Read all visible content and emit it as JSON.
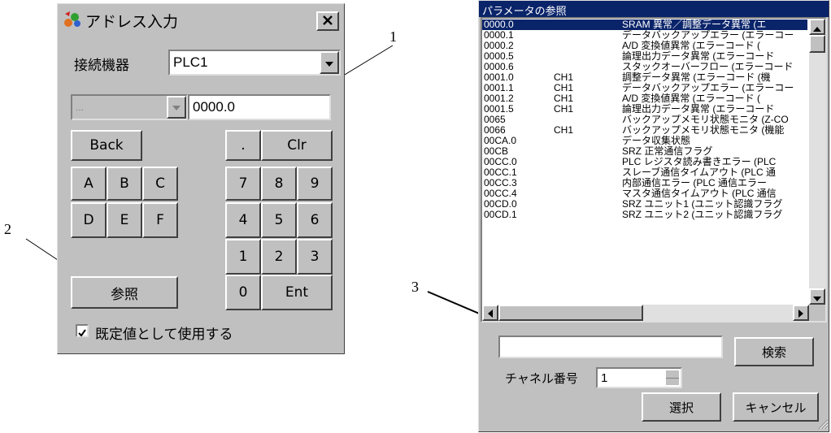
{
  "address_dialog": {
    "title": "アドレス入力",
    "device_label": "接続機器",
    "device_value": "PLC1",
    "sub_select_value": "...",
    "address_value": "0000.0",
    "keys": {
      "back": "Back",
      "dot": ".",
      "clr": "Clr",
      "a": "A",
      "b": "B",
      "c": "C",
      "d": "D",
      "e": "E",
      "f": "F",
      "k7": "7",
      "k8": "8",
      "k9": "9",
      "k4": "4",
      "k5": "5",
      "k6": "6",
      "k1": "1",
      "k2": "2",
      "k3": "3",
      "k0": "0",
      "ent": "Ent",
      "ref": "参照"
    },
    "default_checkbox_label": "既定値として使用する",
    "default_checked": true
  },
  "param_dialog": {
    "title": "パラメータの参照",
    "rows": [
      {
        "addr": "0000.0",
        "ch": "",
        "desc": "SRAM 異常／調整データ異常 (エ"
      },
      {
        "addr": "0000.1",
        "ch": "",
        "desc": "データバックアップエラー (エラーコー"
      },
      {
        "addr": "0000.2",
        "ch": "",
        "desc": "A/D 変換値異常 (エラーコード ("
      },
      {
        "addr": "0000.5",
        "ch": "",
        "desc": "論理出力データ異常 (エラーコード"
      },
      {
        "addr": "0000.6",
        "ch": "",
        "desc": "スタックオーバーフロー (エラーコード"
      },
      {
        "addr": "0001.0",
        "ch": "CH1",
        "desc": "調整データ異常 (エラーコード (機"
      },
      {
        "addr": "0001.1",
        "ch": "CH1",
        "desc": "データバックアップエラー (エラーコー"
      },
      {
        "addr": "0001.2",
        "ch": "CH1",
        "desc": "A/D 変換値異常 (エラーコード ("
      },
      {
        "addr": "0001.5",
        "ch": "CH1",
        "desc": "論理出力データ異常 (エラーコード"
      },
      {
        "addr": "0065",
        "ch": "",
        "desc": "バックアップメモリ状態モニタ (Z-CO"
      },
      {
        "addr": "0066",
        "ch": "CH1",
        "desc": "バックアップメモリ状態モニタ (機能"
      },
      {
        "addr": "00CA.0",
        "ch": "",
        "desc": "データ収集状態"
      },
      {
        "addr": "00CB",
        "ch": "",
        "desc": "SRZ 正常通信フラグ"
      },
      {
        "addr": "00CC.0",
        "ch": "",
        "desc": "PLC レジスタ読み書きエラー (PLC"
      },
      {
        "addr": "00CC.1",
        "ch": "",
        "desc": "スレーブ通信タイムアウト (PLC 通"
      },
      {
        "addr": "00CC.3",
        "ch": "",
        "desc": "内部通信エラー (PLC 通信エラー"
      },
      {
        "addr": "00CC.4",
        "ch": "",
        "desc": "マスタ通信タイムアウト (PLC 通信"
      },
      {
        "addr": "00CD.0",
        "ch": "",
        "desc": "SRZ ユニット1 (ユニット認識フラグ"
      },
      {
        "addr": "00CD.1",
        "ch": "",
        "desc": "SRZ ユニット2 (ユニット認識フラグ"
      }
    ],
    "search_value": "",
    "search_button": "検索",
    "channel_label": "チャネル番号",
    "channel_value": "1",
    "select_button": "選択",
    "cancel_button": "キャンセル"
  },
  "callouts": {
    "c1": "1",
    "c2": "2",
    "c3": "3"
  },
  "colors": {
    "face": "#c0c0c0",
    "title_bar": "#0a246a",
    "selection": "#0a246a",
    "scroll_track": "#e0e0e0"
  },
  "icons": {
    "app": "app-icon",
    "close": "close-icon",
    "combo": "chevron-down-icon",
    "check": "checkmark-icon",
    "resize": "resize-grip-icon"
  }
}
